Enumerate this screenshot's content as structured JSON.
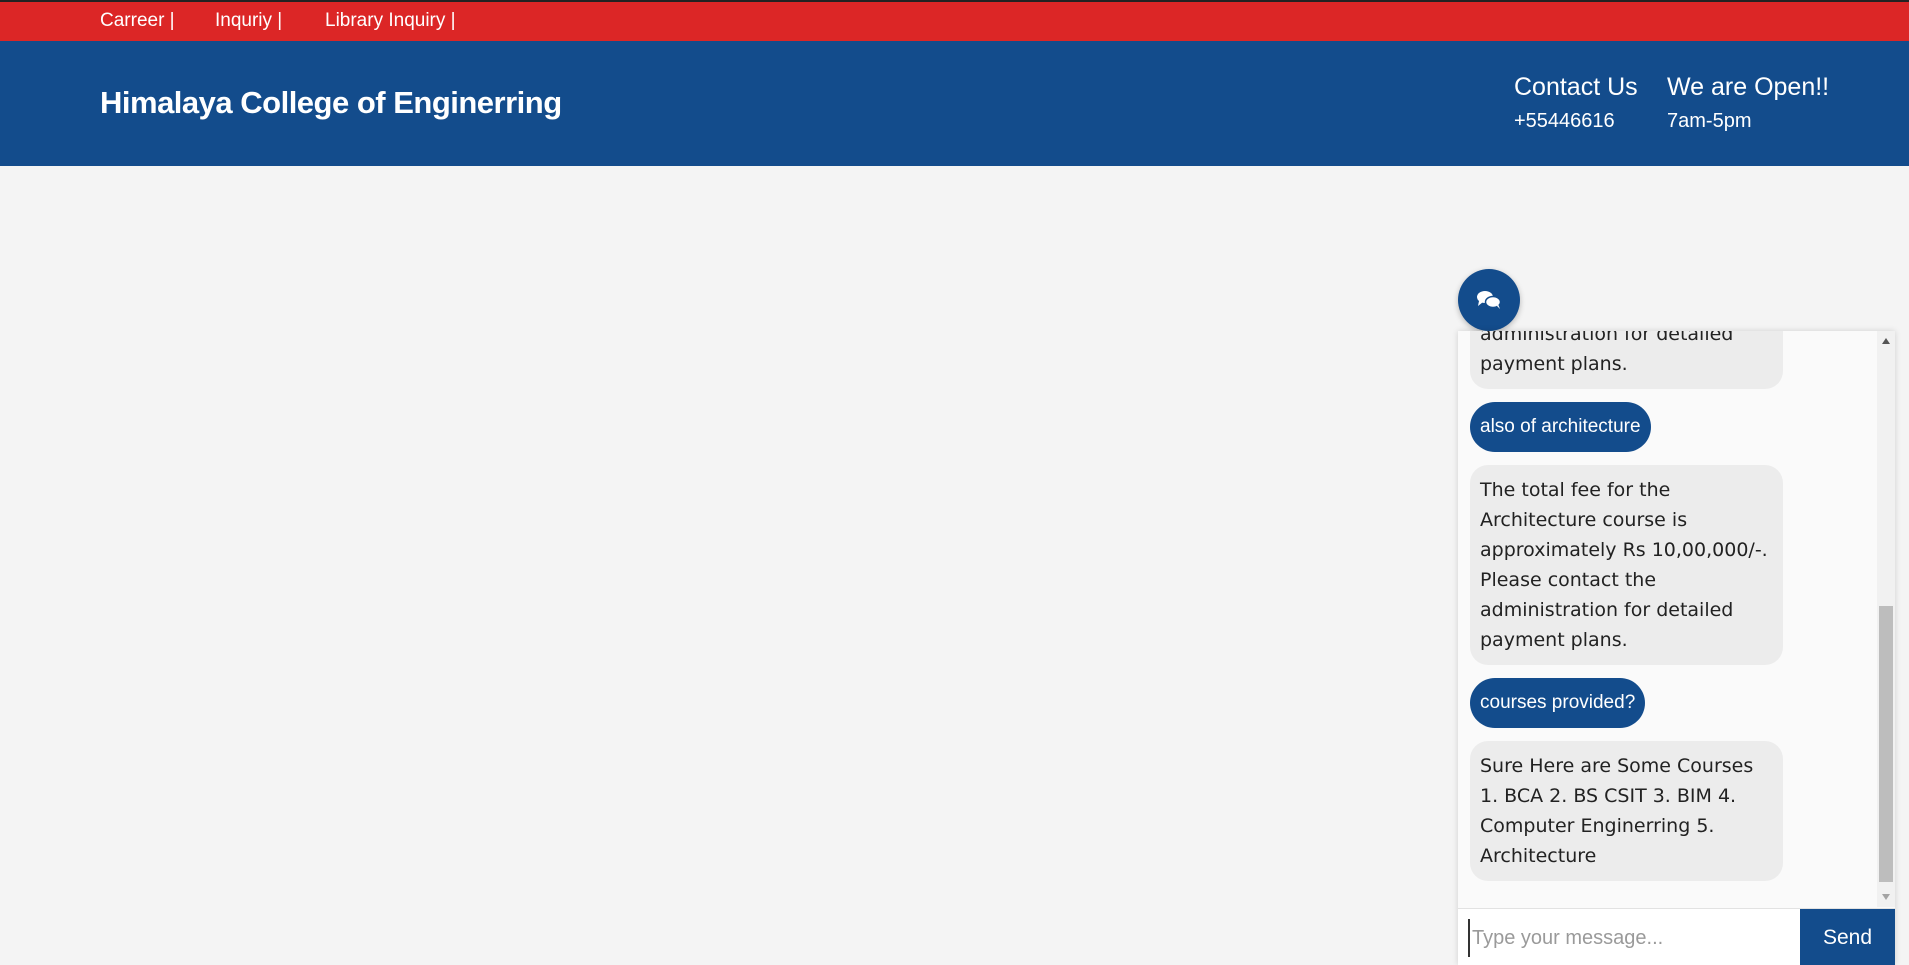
{
  "topbar": {
    "links": [
      "Carreer |",
      "Inquriy |",
      "Library Inquiry |"
    ]
  },
  "header": {
    "brand": "Himalaya College of Enginerring",
    "contact_title": "Contact Us",
    "contact_phone": "+55446616",
    "hours_title": "We are Open!!",
    "hours_value": "7am-5pm"
  },
  "chat": {
    "toggle_icon": "chat-bubbles-icon",
    "messages": [
      {
        "from": "bot",
        "text": "Please contact the administration for detailed payment plans."
      },
      {
        "from": "user",
        "text": "also of architecture"
      },
      {
        "from": "bot",
        "text": "The total fee for the Architecture course is approximately Rs 10,00,000/-. Please contact the administration for detailed payment plans."
      },
      {
        "from": "user",
        "text": "courses provided?"
      },
      {
        "from": "bot",
        "text": "Sure Here are Some Courses 1. BCA 2. BS CSIT 3. BIM 4. Computer Enginerring 5. Architecture"
      }
    ],
    "input_placeholder": "Type your message...",
    "input_value": "",
    "send_label": "Send"
  },
  "colors": {
    "topbar": "#dc2626",
    "primary": "#134c8c",
    "bot_bubble": "#ececec"
  }
}
